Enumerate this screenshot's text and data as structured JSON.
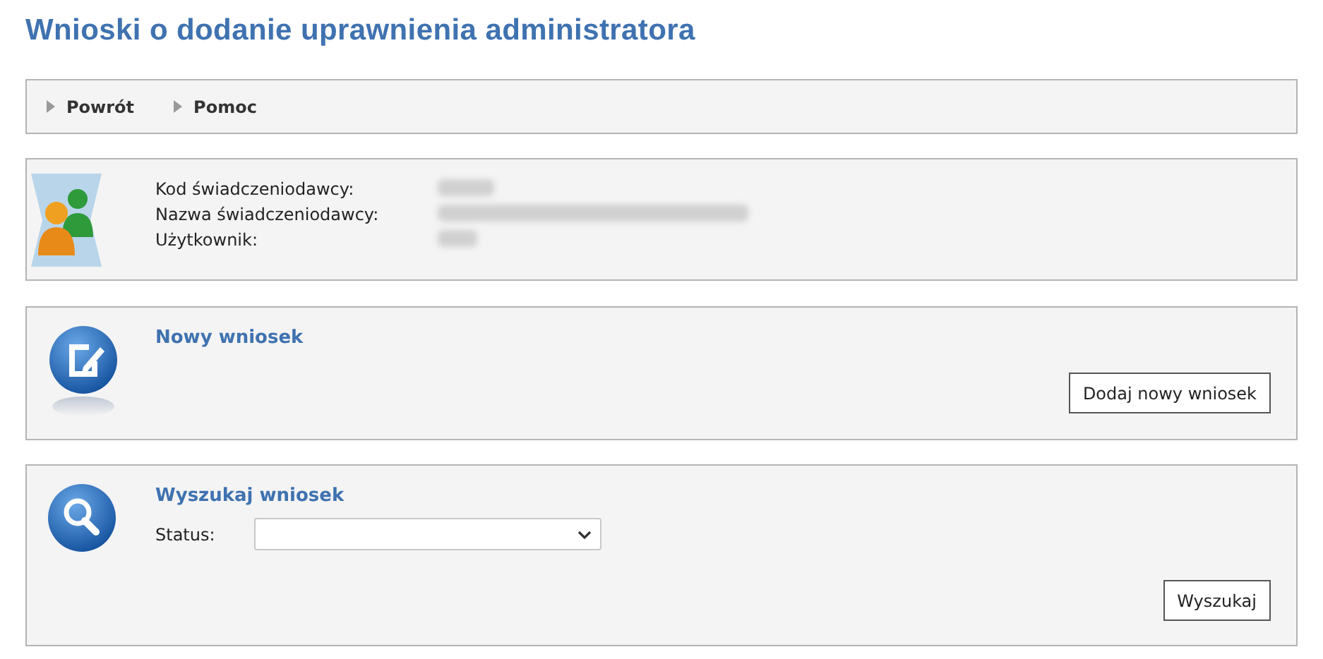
{
  "page_title": "Wnioski o dodanie uprawnienia administratora",
  "nav_links": [
    "Powrót",
    "Pomoc"
  ],
  "info": {
    "labels": [
      "Kod świadczeniodawcy:",
      "Nazwa świadczeniodawcy:",
      "Użytkownik:"
    ]
  },
  "new_request": {
    "title": "Nowy wniosek",
    "button": "Dodaj nowy wniosek"
  },
  "search": {
    "title": "Wyszukaj wniosek",
    "status_label": "Status:",
    "button": "Wyszukaj"
  }
}
